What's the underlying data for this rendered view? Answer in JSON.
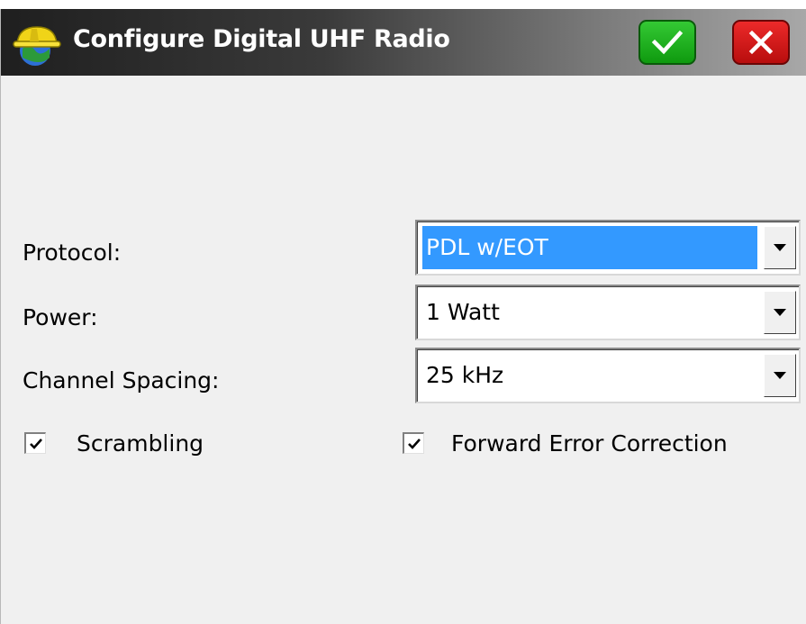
{
  "window": {
    "title": "Configure Digital UHF Radio",
    "app_icon": "survey-helmet-globe-icon",
    "ok_icon": "checkmark-icon",
    "cancel_icon": "close-x-icon"
  },
  "colors": {
    "ok": "#1aa81a",
    "cancel": "#d81414",
    "selection": "#3399ff",
    "background": "#f0f0f0"
  },
  "form": {
    "protocol": {
      "label": "Protocol:",
      "value": "PDL w/EOT"
    },
    "power": {
      "label": "Power:",
      "value": "1 Watt"
    },
    "channel_spacing": {
      "label": "Channel Spacing:",
      "value": "25 kHz"
    },
    "scrambling": {
      "label": "Scrambling",
      "checked": true
    },
    "fec": {
      "label": "Forward Error Correction",
      "checked": true
    }
  }
}
